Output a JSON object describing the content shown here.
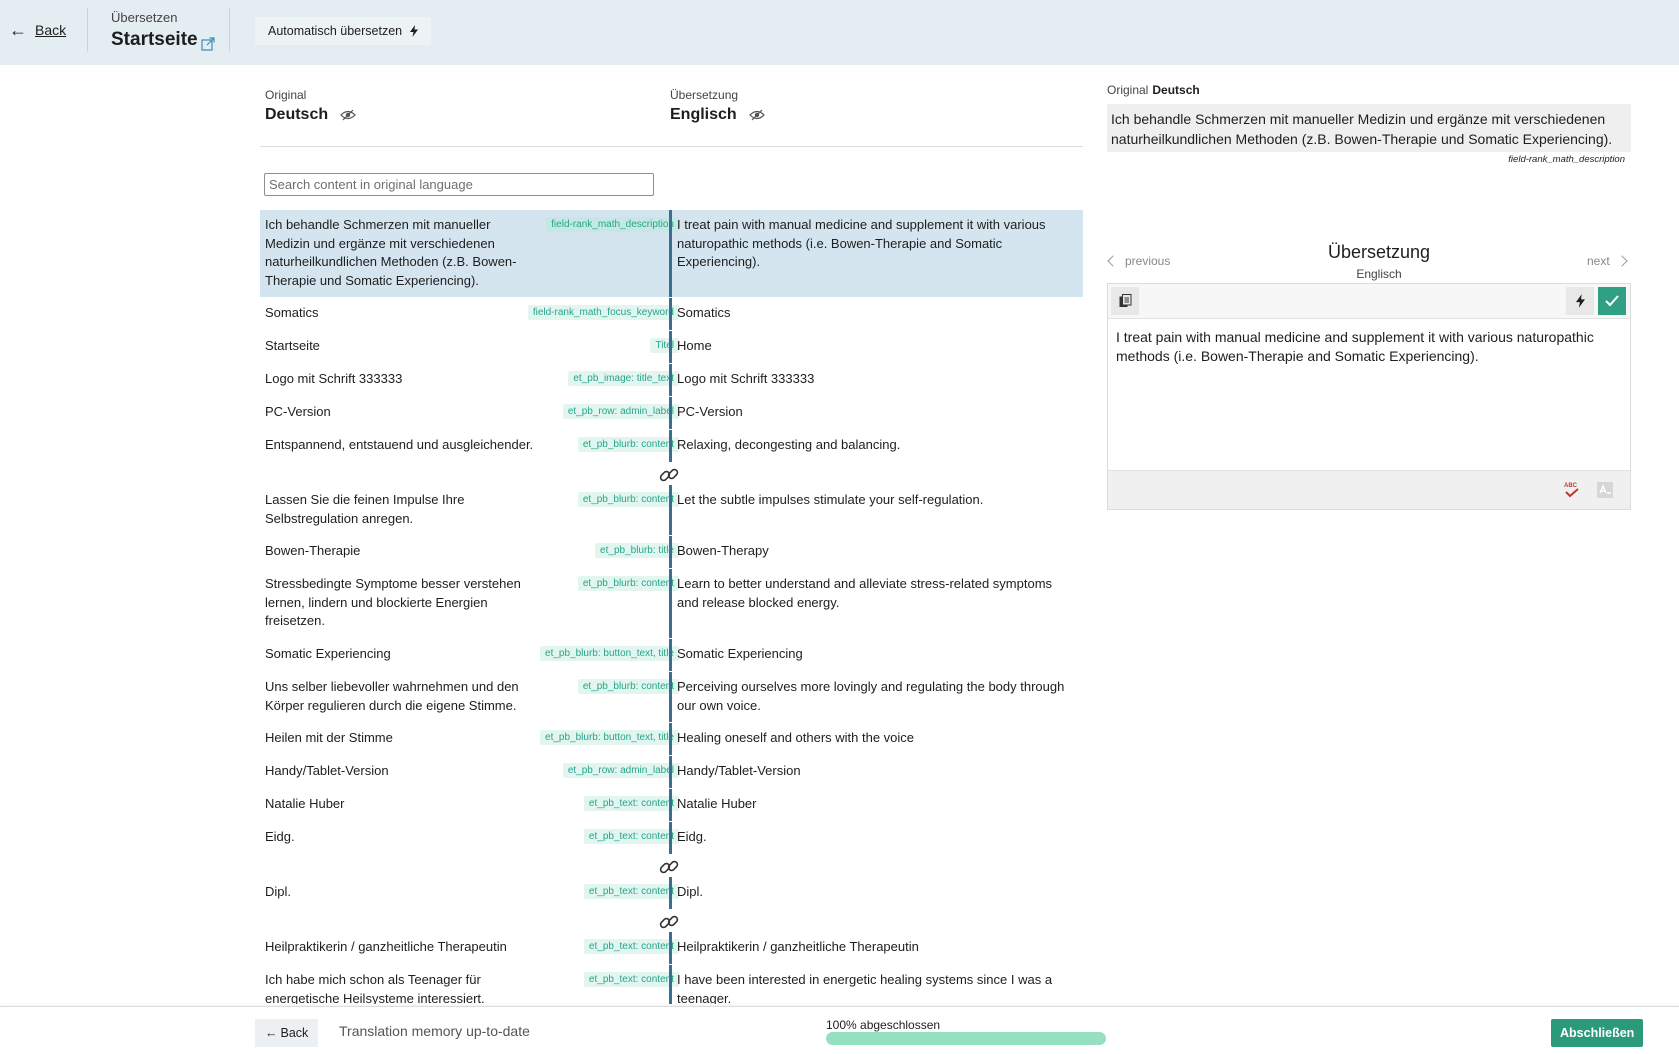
{
  "header": {
    "back_label": "Back",
    "subtitle": "Übersetzen",
    "page_title": "Startseite",
    "auto_translate_label": "Automatisch übersetzen"
  },
  "columns": {
    "original_label": "Original",
    "original_lang": "Deutsch",
    "translation_label": "Übersetzung",
    "translation_lang": "Englisch"
  },
  "search": {
    "placeholder": "Search content in original language"
  },
  "rows": [
    {
      "orig": "Ich behandle Schmerzen mit manueller Medizin und ergänze mit verschiedenen naturheilkundlichen Methoden (z.B. Bowen-Therapie und Somatic Experiencing).",
      "tag": "field-rank_math_description",
      "trans": "I treat pain with manual medicine and supplement it with various naturopathic methods (i.e. Bowen-Therapie and Somatic Experiencing).",
      "selected": true
    },
    {
      "orig": "Somatics",
      "tag": "field-rank_math_focus_keyword",
      "trans": "Somatics"
    },
    {
      "orig": "Startseite",
      "tag": "Titel",
      "trans": "Home"
    },
    {
      "orig": "Logo mit Schrift 333333",
      "tag": "et_pb_image: title_text",
      "trans": "Logo mit Schrift 333333"
    },
    {
      "orig": "PC-Version",
      "tag": "et_pb_row: admin_label",
      "trans": "PC-Version"
    },
    {
      "orig": "Entspannend, entstauend und ausgleichender.",
      "tag": "et_pb_blurb: content",
      "trans": "Relaxing, decongesting and balancing."
    },
    {
      "link": true
    },
    {
      "orig": "Lassen Sie die feinen Impulse Ihre Selbstregulation anregen.",
      "tag": "et_pb_blurb: content",
      "trans": "Let the subtle impulses stimulate your self-regulation."
    },
    {
      "orig": "Bowen-Therapie",
      "tag": "et_pb_blurb: title",
      "trans": "Bowen-Therapy"
    },
    {
      "orig": "Stressbedingte Symptome besser verstehen lernen, lindern und blockierte Energien freisetzen.",
      "tag": "et_pb_blurb: content",
      "trans": "Learn to better understand and alleviate stress-related symptoms and release blocked energy."
    },
    {
      "orig": "Somatic Experiencing",
      "tag": "et_pb_blurb: button_text, title",
      "trans": "Somatic Experiencing"
    },
    {
      "orig": "Uns selber liebevoller wahrnehmen und den Körper regulieren durch die eigene Stimme.",
      "tag": "et_pb_blurb: content",
      "trans": "Perceiving ourselves more lovingly and regulating the body through our own voice."
    },
    {
      "orig": "Heilen mit der Stimme",
      "tag": "et_pb_blurb: button_text, title",
      "trans": "Healing oneself and others with the voice"
    },
    {
      "orig": "Handy/Tablet-Version",
      "tag": "et_pb_row: admin_label",
      "trans": "Handy/Tablet-Version"
    },
    {
      "orig": "Natalie Huber",
      "tag": "et_pb_text: content",
      "trans": "Natalie Huber"
    },
    {
      "orig": "Eidg.",
      "tag": "et_pb_text: content",
      "trans": "Eidg."
    },
    {
      "link": true
    },
    {
      "orig": "Dipl.",
      "tag": "et_pb_text: content",
      "trans": "Dipl."
    },
    {
      "link": true
    },
    {
      "orig": "Heilpraktikerin / ganzheitliche Therapeutin",
      "tag": "et_pb_text: content",
      "trans": "Heilpraktikerin / ganzheitliche Therapeutin"
    },
    {
      "orig": "Ich habe mich schon als Teenager für energetische Heilsysteme interessiert.",
      "tag": "et_pb_text: content",
      "trans": "I have been interested in energetic healing systems since I was a teenager."
    },
    {
      "link": true
    }
  ],
  "right_panel": {
    "original_label": "Original",
    "original_lang": "Deutsch",
    "original_text": "Ich behandle Schmerzen mit manueller Medizin und ergänze mit verschiedenen naturheilkundlichen Methoden (z.B. Bowen-Therapie und Somatic Experiencing).",
    "field_name": "field-rank_math_description",
    "prev_label": "previous",
    "next_label": "next",
    "translation_title": "Übersetzung",
    "translation_lang": "Englisch",
    "translation_text": "I treat pain with manual medicine and supplement it with various naturopathic methods (i.e. Bowen-Therapie and Somatic Experiencing).",
    "spellcheck_icon_text": "ABC"
  },
  "footer": {
    "back_label": "Back",
    "status": "Translation memory up-to-date",
    "progress_label": "100% abgeschlossen",
    "progress_fraction": 1.0,
    "finish_label": "Abschließen"
  },
  "colors": {
    "header_bg": "#e3edf2",
    "accent_green": "#2b9a7b",
    "tag_green": "#23a68c",
    "divider_blue": "#3a6f8f",
    "selected_row": "#d4e5ef",
    "progress_fill": "#95dfc2"
  }
}
